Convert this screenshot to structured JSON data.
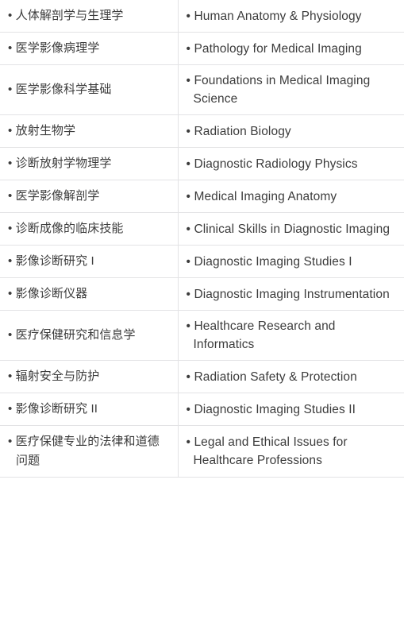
{
  "table": {
    "bullet": "•",
    "columns": [
      "chinese",
      "english"
    ],
    "rows": [
      {
        "zh": "人体解剖学与生理学",
        "en": "Human Anatomy & Physiology"
      },
      {
        "zh": "医学影像病理学",
        "en": "Pathology for Medical Imaging"
      },
      {
        "zh": "医学影像科学基础",
        "en": "Foundations in Medical Imaging Science"
      },
      {
        "zh": "放射生物学",
        "en": "Radiation Biology"
      },
      {
        "zh": "诊断放射学物理学",
        "en": "Diagnostic Radiology Physics"
      },
      {
        "zh": "医学影像解剖学",
        "en": "Medical Imaging Anatomy"
      },
      {
        "zh": "诊断成像的临床技能",
        "en": "Clinical Skills in Diagnostic Imaging"
      },
      {
        "zh": "影像诊断研究 I",
        "en": "Diagnostic Imaging Studies I"
      },
      {
        "zh": "影像诊断仪器",
        "en": "Diagnostic Imaging Instrumentation"
      },
      {
        "zh": "医疗保健研究和信息学",
        "en": "Healthcare Research and Informatics"
      },
      {
        "zh": "辐射安全与防护",
        "en": "Radiation Safety & Protection"
      },
      {
        "zh": "影像诊断研究 II",
        "en": "Diagnostic Imaging Studies II"
      },
      {
        "zh": "医疗保健专业的法律和道德问题",
        "en": "Legal and Ethical Issues for Healthcare Professions"
      }
    ]
  },
  "colors": {
    "text": "#3c3c3c",
    "divider": "#e3e3e5",
    "background": "#ffffff"
  }
}
